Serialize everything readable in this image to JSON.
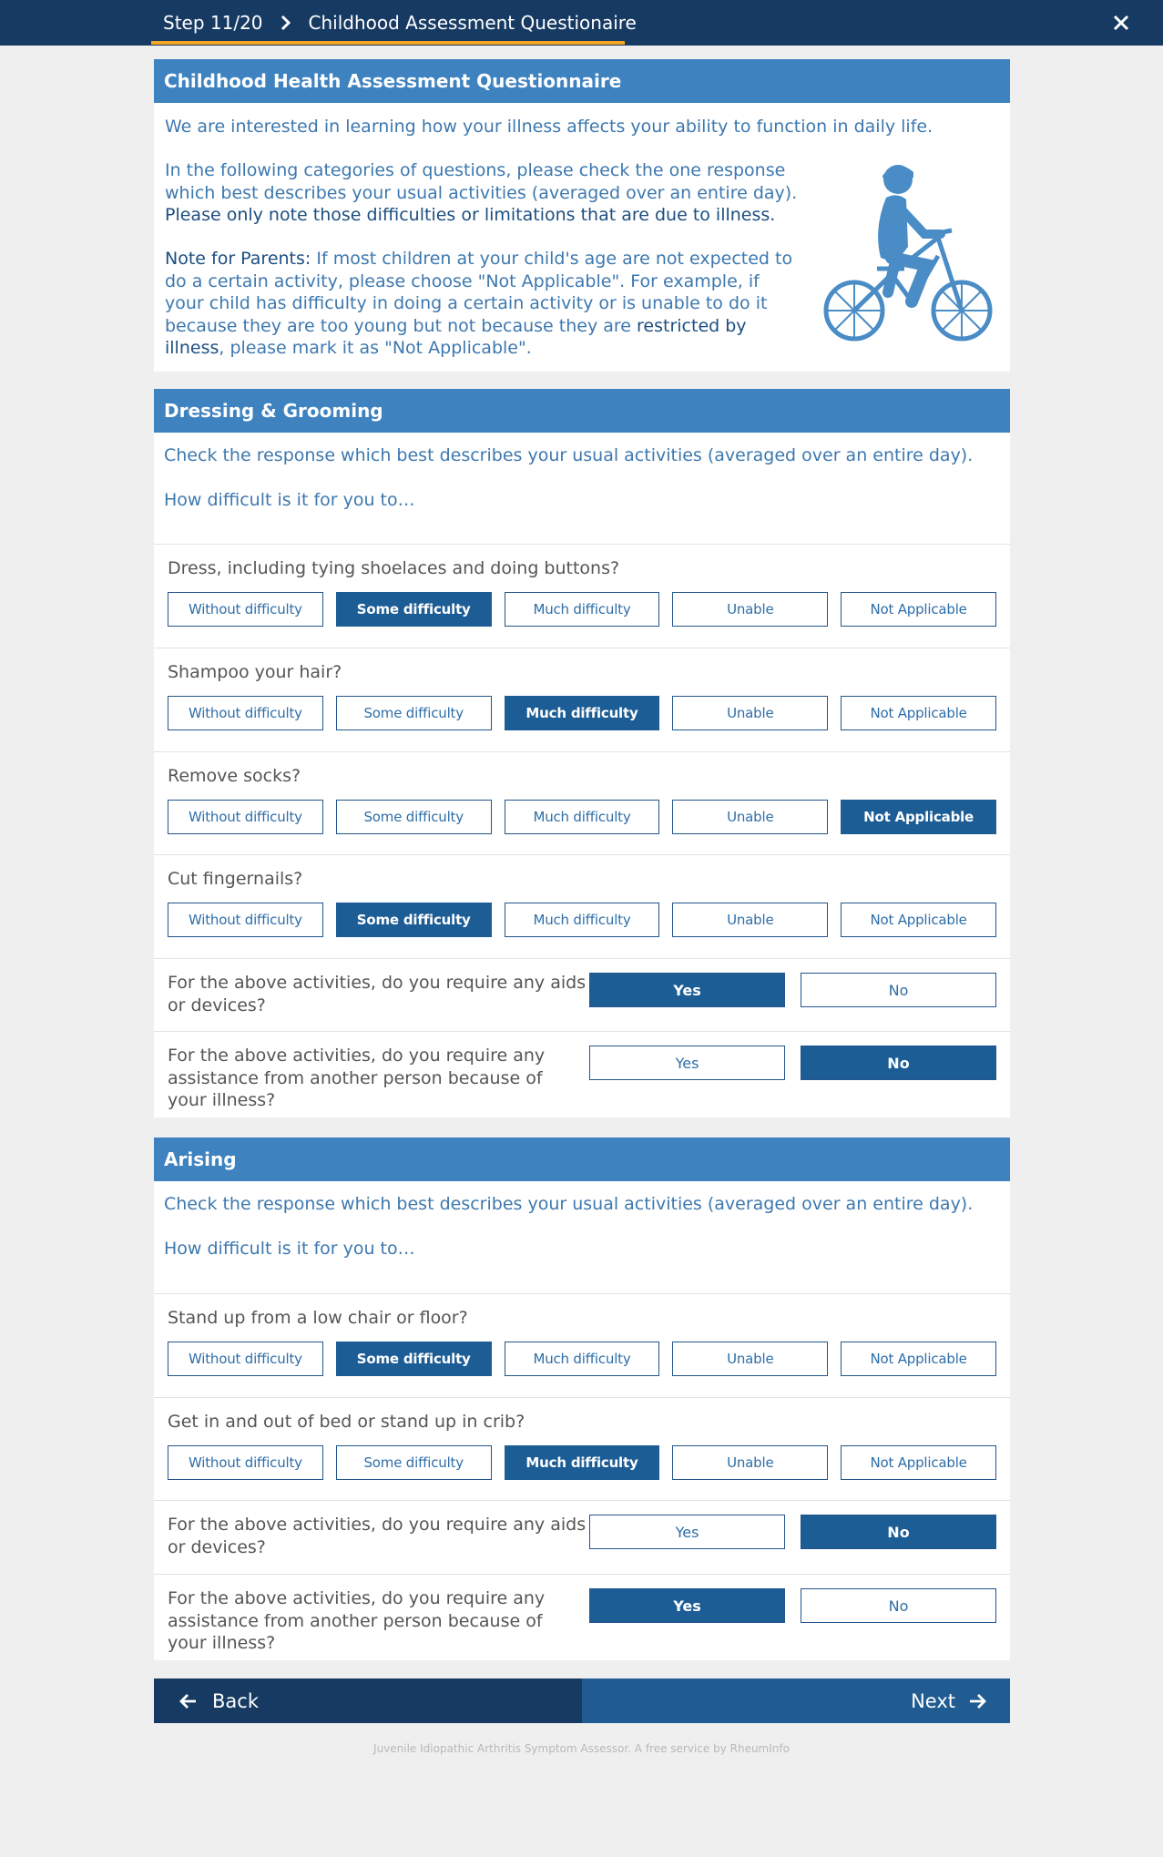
{
  "topbar": {
    "step": "Step 11/20",
    "title": "Childhood Assessment Questionaire"
  },
  "intro": {
    "header": "Childhood Health Assessment Questionnaire",
    "p1": "We are interested in learning how your illness affects your ability to function in daily life.",
    "p2_a": "In the following categories of questions, please check the one response which best describes your usual activities (averaged over an entire day).",
    "p2_b": "Please only note those difficulties or limitations that are due to illness.",
    "p3_label": "Note for Parents:",
    "p3_a": "If most children at your child's age are not expected to do a certain activity, please choose \"Not Applicable\". For example, if your child has difficulty in doing a certain activity or is unable to do it because they are too young but not because they are",
    "p3_strong": "restricted by illness",
    "p3_b": ", please mark it as \"Not Applicable\"."
  },
  "options": [
    "Without difficulty",
    "Some difficulty",
    "Much difficulty",
    "Unable",
    "Not Applicable"
  ],
  "yes_label": "Yes",
  "no_label": "No",
  "dressing": {
    "header": "Dressing & Grooming",
    "instruction": "Check the response which best describes your usual activities (averaged over an entire day).",
    "prompt": "How difficult is it for you to…",
    "questions": [
      {
        "text": "Dress, including tying shoelaces and doing buttons?",
        "selected": 1
      },
      {
        "text": "Shampoo your hair?",
        "selected": 2
      },
      {
        "text": "Remove socks?",
        "selected": 4
      },
      {
        "text": "Cut fingernails?",
        "selected": 1
      }
    ],
    "aids": {
      "text": "For the above activities, do you require any aids or devices?",
      "answer": "Yes"
    },
    "assist": {
      "text": "For the above activities, do you require any assistance from another person because of your illness?",
      "answer": "No"
    }
  },
  "arising": {
    "header": "Arising",
    "instruction": "Check the response which best describes your usual activities (averaged over an entire day).",
    "prompt": "How difficult is it for you to…",
    "questions": [
      {
        "text": "Stand up from a low chair or floor?",
        "selected": 1
      },
      {
        "text": "Get in and out of bed or stand up in crib?",
        "selected": 2
      }
    ],
    "aids": {
      "text": "For the above activities, do you require any aids or devices?",
      "answer": "No"
    },
    "assist": {
      "text": "For the above activities, do you require any assistance from another person because of your illness?",
      "answer": "Yes"
    }
  },
  "nav": {
    "back": "Back",
    "next": "Next"
  },
  "footer": "Juvenile Idiopathic Arthritis Symptom Assessor. A free service by RheumInfo",
  "colors": {
    "topbar": "#173a63",
    "header": "#3e82c0",
    "accent": "#f5a623",
    "selected": "#1d5d95"
  }
}
